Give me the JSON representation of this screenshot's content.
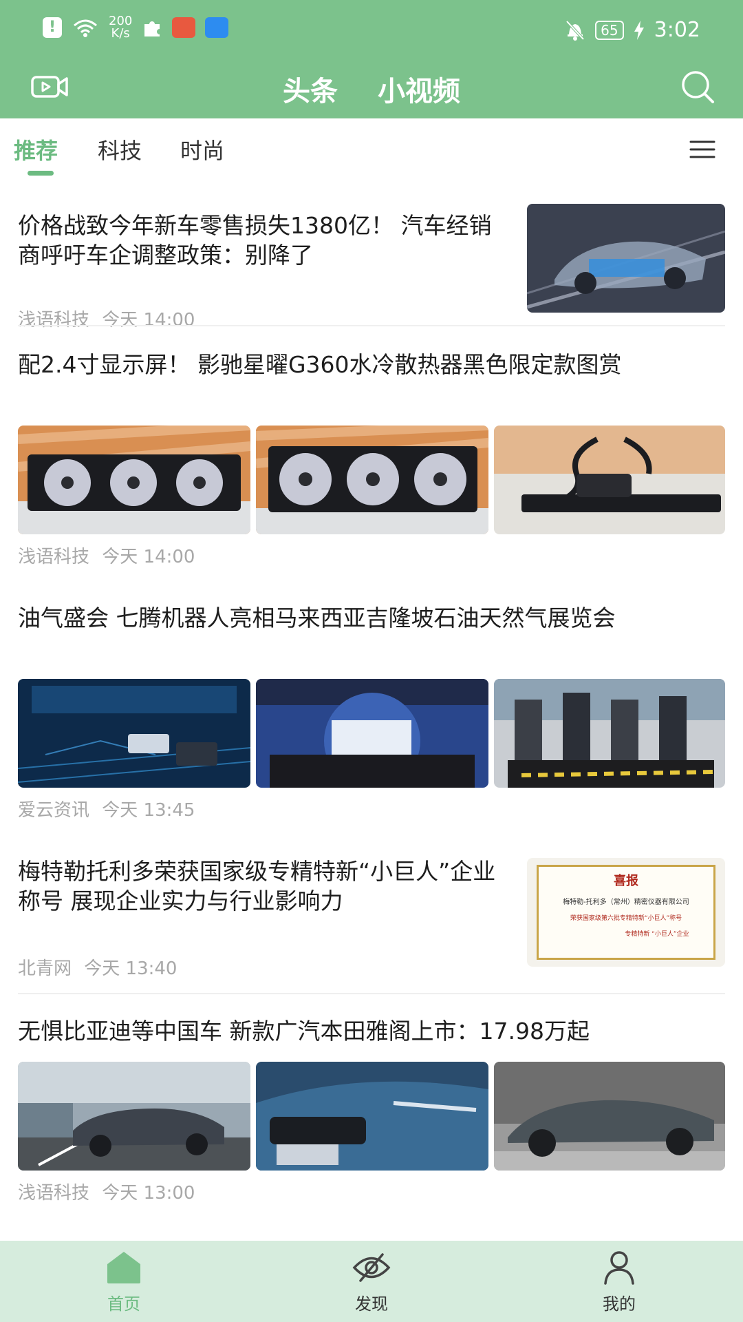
{
  "status_bar": {
    "net_speed_value": "200",
    "net_speed_unit": "K/s",
    "battery": "65",
    "time": "3:02"
  },
  "nav": {
    "tab_headlines": "头条",
    "tab_short_video": "小视频"
  },
  "categories": [
    "推荐",
    "科技",
    "时尚"
  ],
  "articles": [
    {
      "title": "价格战致今年新车零售损失1380亿！ 汽车经销商呼吁车企调整政策：别降了",
      "source": "浅语科技",
      "time": "今天 14:00"
    },
    {
      "title": "配2.4寸显示屏！ 影驰星曜G360水冷散热器黑色限定款图赏",
      "source": "浅语科技",
      "time": "今天 14:00"
    },
    {
      "title": "油气盛会 七腾机器人亮相马来西亚吉隆坡石油天然气展览会",
      "source": "爱云资讯",
      "time": "今天 13:45"
    },
    {
      "title": "梅特勒托利多荣获国家级专精特新“小巨人”企业称号 展现企业实力与行业影响力",
      "source": "北青网",
      "time": "今天 13:40"
    },
    {
      "title": "无惧比亚迪等中国车 新款广汽本田雅阁上市：17.98万起",
      "source": "浅语科技",
      "time": "今天 13:00"
    }
  ],
  "certificate": {
    "heading": "喜报",
    "company": "梅特勒-托利多（常州）精密仪器有限公司",
    "line": "荣获国家级第六批专精特新“小巨人”称号",
    "seal": "专精特新 “小巨人”企业"
  },
  "bottom_nav": {
    "home": "首页",
    "discover": "发现",
    "mine": "我的"
  },
  "colors": {
    "brand_green": "#7cc28c",
    "active_green": "#6cbb81",
    "bottom_bar": "#d6ecdd",
    "meta_gray": "#a8a8a8"
  }
}
